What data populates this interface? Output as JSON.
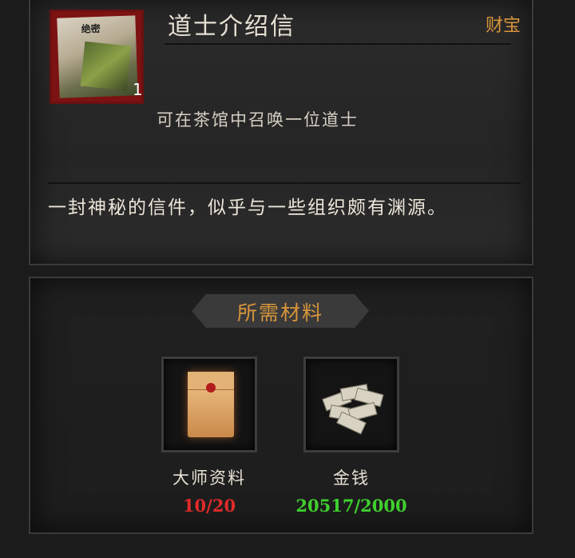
{
  "item": {
    "title": "道士介绍信",
    "category": "财宝",
    "count": "1",
    "card_text": "绝密",
    "effect": "可在茶馆中召唤一位道士",
    "description": "一封神秘的信件，似乎与一些组织颇有渊源。"
  },
  "requirements": {
    "title": "所需材料",
    "materials": [
      {
        "name": "大师资料",
        "count": "10/20",
        "status_color": "#e02a2a",
        "icon": "envelope-icon"
      },
      {
        "name": "金钱",
        "count": "20517/2000",
        "status_color": "#3fd02e",
        "icon": "money-stack-icon"
      }
    ]
  }
}
